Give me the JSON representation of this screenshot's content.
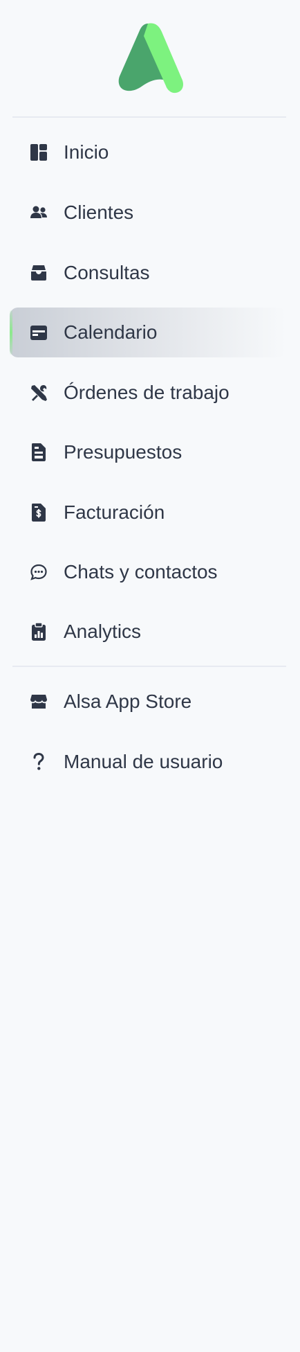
{
  "app": {
    "logo_icon": "alsa-logo",
    "logo_colors": {
      "dark": "#4aa56c",
      "light": "#7df27f"
    }
  },
  "nav": {
    "items": [
      {
        "label": "Inicio",
        "icon": "dashboard-icon",
        "active": false
      },
      {
        "label": "Clientes",
        "icon": "users-icon",
        "active": false
      },
      {
        "label": "Consultas",
        "icon": "inbox-icon",
        "active": false
      },
      {
        "label": "Calendario",
        "icon": "calendar-icon",
        "active": true
      },
      {
        "label": "Órdenes de trabajo",
        "icon": "tools-icon",
        "active": false
      },
      {
        "label": "Presupuestos",
        "icon": "document-icon",
        "active": false
      },
      {
        "label": "Facturación",
        "icon": "invoice-dollar-icon",
        "active": false
      },
      {
        "label": "Chats y contactos",
        "icon": "chat-icon",
        "active": false
      },
      {
        "label": "Analytics",
        "icon": "clipboard-chart-icon",
        "active": false
      }
    ],
    "secondary_items": [
      {
        "label": "Alsa App Store",
        "icon": "store-icon",
        "active": false
      },
      {
        "label": "Manual de usuario",
        "icon": "question-icon",
        "active": false
      }
    ]
  },
  "colors": {
    "background": "#f7f9fb",
    "text": "#2f3747",
    "active_accent": "#8bea8b",
    "divider": "#e7eaf1"
  }
}
